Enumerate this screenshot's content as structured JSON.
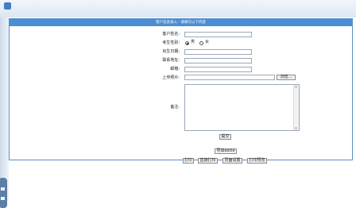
{
  "header": {
    "title": "客户信息录入 · 请填写以下内容"
  },
  "form": {
    "name_label": "客户姓名:",
    "gender_label": "考生性别:",
    "gender_male": "男",
    "gender_female": "女",
    "gender_selected": "男",
    "birthday_label": "出生日期:",
    "address_label": "联系地址:",
    "email_label": "邮箱:",
    "photo_label": "上传照片:",
    "browse_label": "浏览...",
    "remark_label": "备注:",
    "submit_label": "提交",
    "export_label": "导出excle"
  },
  "print_toolbar": {
    "print": "打印",
    "direct_print": "直接打印",
    "page_setup": "页面设置",
    "print_preview": "打印预览"
  },
  "colors": {
    "accent": "#4b8ed4",
    "frame": "#5b8fc7"
  }
}
